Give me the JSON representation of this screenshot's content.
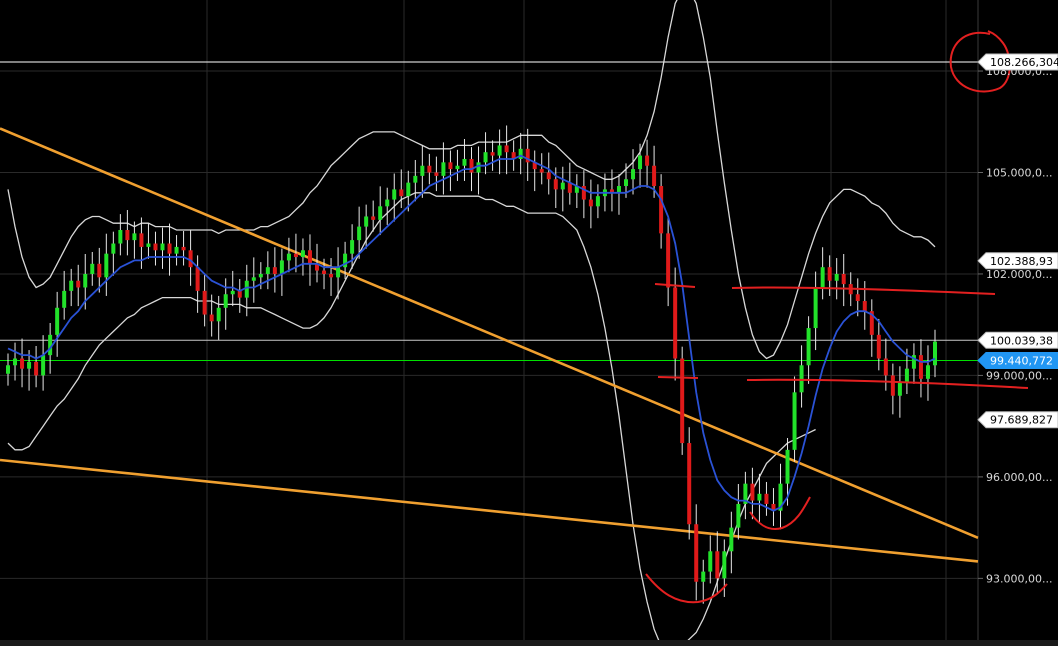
{
  "chart_data": {
    "type": "candlestick",
    "title": "",
    "xlabel": "",
    "ylabel": "",
    "ylim": [
      91.0,
      110.1
    ],
    "grid": true,
    "y_ticks": [
      {
        "value": 108.0,
        "label": "108.000,0..."
      },
      {
        "value": 105.0,
        "label": "105.000,0..."
      },
      {
        "value": 102.0,
        "label": "102.000,0..."
      },
      {
        "value": 99.0,
        "label": "99.000,00..."
      },
      {
        "value": 96.0,
        "label": "96.000,00..."
      },
      {
        "value": 93.0,
        "label": "93.000,00..."
      }
    ],
    "price_labels": [
      {
        "value": 108.266,
        "label": "108.266,304",
        "bg": "#ffffff",
        "fg": "#000000",
        "line": "#ffffff"
      },
      {
        "value": 102.389,
        "label": "102.388,93",
        "bg": "#ffffff",
        "fg": "#000000",
        "line": null
      },
      {
        "value": 100.039,
        "label": "100.039,38",
        "bg": "#ffffff",
        "fg": "#000000",
        "line": "#c8c8c8"
      },
      {
        "value": 99.441,
        "label": "99.440,772",
        "bg": "#2196f3",
        "fg": "#ffffff",
        "line": "#00e000"
      },
      {
        "value": 97.69,
        "label": "97.689,827",
        "bg": "#ffffff",
        "fg": "#000000",
        "line": null
      }
    ],
    "candles_close": [
      99.3,
      99.5,
      99.2,
      99.4,
      99.0,
      99.6,
      100.2,
      101.0,
      101.5,
      101.8,
      101.6,
      102.0,
      102.3,
      101.9,
      102.6,
      102.9,
      103.3,
      103.0,
      103.2,
      102.8,
      102.9,
      102.7,
      102.9,
      102.6,
      102.8,
      102.7,
      102.2,
      101.5,
      100.8,
      100.6,
      101.0,
      101.4,
      101.5,
      101.3,
      101.8,
      101.9,
      102.0,
      102.2,
      102.0,
      102.4,
      102.6,
      102.5,
      102.7,
      102.3,
      102.1,
      102.0,
      101.9,
      102.2,
      102.6,
      103.0,
      103.4,
      103.7,
      103.6,
      104.0,
      104.2,
      104.5,
      104.3,
      104.7,
      104.9,
      105.2,
      105.0,
      104.9,
      105.3,
      105.1,
      105.2,
      105.4,
      105.0,
      105.3,
      105.6,
      105.5,
      105.8,
      105.6,
      105.4,
      105.7,
      105.3,
      105.1,
      105.0,
      104.8,
      104.5,
      104.7,
      104.4,
      104.6,
      104.2,
      104.0,
      104.3,
      104.5,
      104.4,
      104.6,
      104.8,
      105.1,
      105.5,
      105.2,
      104.6,
      103.2,
      101.6,
      99.5,
      97.0,
      94.6,
      92.9,
      93.2,
      93.8,
      93.0,
      93.8,
      94.5,
      95.2,
      95.8,
      95.3,
      95.5,
      95.2,
      95.0,
      95.8,
      96.8,
      98.5,
      99.3,
      100.4,
      101.6,
      102.2,
      101.8,
      102.0,
      101.7,
      101.4,
      101.2,
      100.9,
      100.2,
      99.5,
      99.0,
      98.4,
      98.8,
      99.2,
      99.6,
      98.9,
      99.3,
      100.0
    ],
    "series": [
      {
        "name": "",
        "type": "line",
        "color": "#2a52d6",
        "values": [
          99.8,
          99.7,
          99.6,
          99.6,
          99.5,
          99.6,
          99.8,
          100.1,
          100.4,
          100.7,
          100.9,
          101.2,
          101.4,
          101.6,
          101.8,
          102.0,
          102.2,
          102.3,
          102.4,
          102.4,
          102.5,
          102.5,
          102.5,
          102.5,
          102.5,
          102.5,
          102.4,
          102.2,
          102.0,
          101.8,
          101.7,
          101.6,
          101.6,
          101.5,
          101.6,
          101.6,
          101.7,
          101.8,
          101.9,
          102.0,
          102.1,
          102.2,
          102.3,
          102.3,
          102.3,
          102.2,
          102.2,
          102.2,
          102.3,
          102.4,
          102.6,
          102.8,
          103.0,
          103.2,
          103.4,
          103.6,
          103.8,
          104.0,
          104.2,
          104.4,
          104.6,
          104.7,
          104.8,
          104.9,
          105.0,
          105.1,
          105.1,
          105.2,
          105.2,
          105.3,
          105.4,
          105.4,
          105.4,
          105.5,
          105.4,
          105.3,
          105.2,
          105.1,
          104.9,
          104.8,
          104.7,
          104.6,
          104.5,
          104.4,
          104.4,
          104.4,
          104.4,
          104.4,
          104.4,
          104.5,
          104.6,
          104.6,
          104.5,
          104.2,
          103.7,
          102.9,
          101.7,
          100.1,
          98.5,
          97.3,
          96.5,
          95.9,
          95.6,
          95.4,
          95.3,
          95.3,
          95.2,
          95.2,
          95.1,
          95.0,
          95.1,
          95.4,
          96.0,
          96.7,
          97.5,
          98.4,
          99.2,
          99.8,
          100.3,
          100.6,
          100.8,
          100.9,
          100.9,
          100.8,
          100.6,
          100.3,
          100.0,
          99.8,
          99.6,
          99.5,
          99.4,
          99.4,
          99.5
        ]
      },
      {
        "name": "",
        "type": "line",
        "color": "#d8d8d8",
        "values": [
          104.5,
          103.4,
          102.5,
          101.9,
          101.6,
          101.7,
          101.9,
          102.3,
          102.7,
          103.1,
          103.4,
          103.6,
          103.7,
          103.7,
          103.6,
          103.5,
          103.5,
          103.5,
          103.4,
          103.5,
          103.5,
          103.4,
          103.4,
          103.4,
          103.3,
          103.3,
          103.3,
          103.3,
          103.3,
          103.3,
          103.2,
          103.3,
          103.3,
          103.3,
          103.3,
          103.3,
          103.4,
          103.4,
          103.5,
          103.6,
          103.7,
          103.9,
          104.1,
          104.4,
          104.6,
          104.9,
          105.2,
          105.4,
          105.6,
          105.8,
          106.0,
          106.1,
          106.2,
          106.2,
          106.2,
          106.2,
          106.1,
          106.0,
          105.9,
          105.8,
          105.7,
          105.7,
          105.7,
          105.7,
          105.8,
          105.8,
          105.8,
          105.9,
          105.9,
          105.9,
          105.9,
          105.9,
          106.0,
          106.1,
          106.1,
          106.1,
          106.1,
          105.9,
          105.8,
          105.6,
          105.4,
          105.2,
          105.1,
          105.0,
          104.9,
          104.8,
          104.8,
          104.9,
          105.1,
          105.3,
          105.6,
          106.1,
          106.8,
          107.8,
          109.0,
          110.0,
          110.4,
          110.4,
          110.0,
          109.0,
          107.8,
          106.2,
          104.7,
          103.3,
          102.0,
          101.0,
          100.2,
          99.7,
          99.5,
          99.6,
          100.0,
          100.5,
          101.2,
          101.9,
          102.6,
          103.2,
          103.7,
          104.1,
          104.3,
          104.5,
          104.5,
          104.4,
          104.3,
          104.1,
          104.0,
          103.8,
          103.5,
          103.3,
          103.2,
          103.1,
          103.1,
          103.0,
          102.8
        ]
      },
      {
        "name": "",
        "type": "line",
        "color": "#d8d8d8",
        "values": [
          97.0,
          96.8,
          96.8,
          96.9,
          97.2,
          97.5,
          97.8,
          98.1,
          98.3,
          98.6,
          98.9,
          99.3,
          99.6,
          99.9,
          100.1,
          100.3,
          100.5,
          100.7,
          100.8,
          101.0,
          101.1,
          101.2,
          101.3,
          101.3,
          101.3,
          101.3,
          101.3,
          101.2,
          101.2,
          101.2,
          101.1,
          101.1,
          101.1,
          101.1,
          101.0,
          101.0,
          101.0,
          100.9,
          100.8,
          100.7,
          100.6,
          100.5,
          100.4,
          100.4,
          100.5,
          100.7,
          101.0,
          101.4,
          101.8,
          102.2,
          102.6,
          103.0,
          103.3,
          103.6,
          103.8,
          104.0,
          104.2,
          104.3,
          104.4,
          104.4,
          104.4,
          104.3,
          104.3,
          104.3,
          104.3,
          104.3,
          104.3,
          104.3,
          104.2,
          104.2,
          104.1,
          104.0,
          104.0,
          103.9,
          103.8,
          103.8,
          103.8,
          103.8,
          103.8,
          103.7,
          103.5,
          103.3,
          102.8,
          102.2,
          101.4,
          100.4,
          99.2,
          97.8,
          96.2,
          94.6,
          93.3,
          92.3,
          91.5,
          91.0,
          91.0,
          91.0,
          91.0,
          91.2,
          91.4,
          91.8,
          92.3,
          92.9,
          93.5,
          94.1,
          94.7,
          95.2,
          95.6,
          96.0,
          96.4,
          96.6,
          96.8,
          97.0,
          97.1,
          97.2,
          97.3,
          97.4
        ]
      },
      {
        "name": "",
        "type": "line",
        "color": "#f0a030",
        "values": [
          106.3,
          94.2
        ]
      },
      {
        "name": "",
        "type": "line",
        "color": "#f0a030",
        "values": [
          96.5,
          93.5
        ]
      }
    ]
  }
}
